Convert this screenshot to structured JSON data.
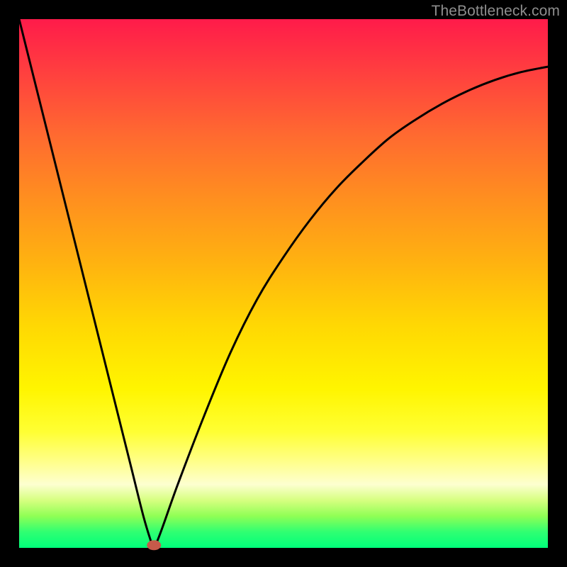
{
  "watermark": "TheBottleneck.com",
  "chart_data": {
    "type": "line",
    "title": "",
    "xlabel": "",
    "ylabel": "",
    "xlim": [
      0,
      100
    ],
    "ylim": [
      0,
      100
    ],
    "x": [
      0,
      3,
      6,
      9,
      12,
      15,
      18,
      21,
      23.5,
      25,
      26,
      30,
      35,
      40,
      45,
      50,
      55,
      60,
      65,
      70,
      75,
      80,
      85,
      90,
      95,
      100
    ],
    "values": [
      100,
      88,
      76,
      64,
      52,
      40,
      28,
      16,
      6,
      1,
      1,
      12,
      25,
      37,
      47,
      55,
      62,
      68,
      73,
      77.5,
      81,
      84,
      86.5,
      88.5,
      90,
      91
    ],
    "minimum_marker": {
      "x": 25.5,
      "y": 0.5
    },
    "gradient_stops": [
      {
        "pos": 0.0,
        "color": "#ff1b4a"
      },
      {
        "pos": 0.58,
        "color": "#ffd803"
      },
      {
        "pos": 0.84,
        "color": "#ffff8f"
      },
      {
        "pos": 1.0,
        "color": "#00ff7a"
      }
    ]
  }
}
